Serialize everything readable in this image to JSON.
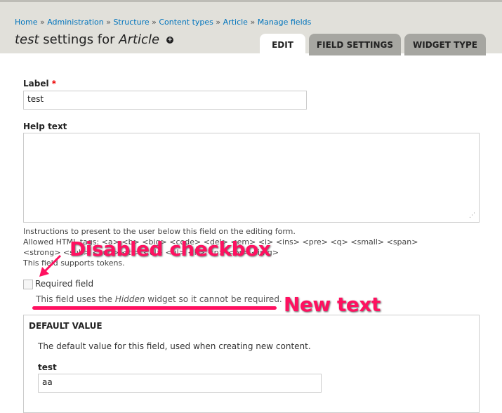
{
  "breadcrumb": [
    "Home",
    "Administration",
    "Structure",
    "Content types",
    "Article",
    "Manage fields"
  ],
  "title": {
    "field": "test",
    "middle": " settings for ",
    "bundle": "Article"
  },
  "tabs": [
    "EDIT",
    "FIELD SETTINGS",
    "WIDGET TYPE"
  ],
  "label": {
    "label": "Label",
    "required_mark": "*",
    "value": "test"
  },
  "help": {
    "label": "Help text",
    "value": "",
    "description": [
      "Instructions to present to the user below this field on the editing form.",
      "Allowed HTML tags: <a> <b> <big> <code> <del> <em> <i> <ins> <pre> <q> <small> <span>",
      "<strong> <sub> <sup> <tt> <ol> <ul> <li> <p> <br> <img>",
      "This field supports tokens."
    ]
  },
  "required": {
    "label": "Required field",
    "note_pre": "This field uses the ",
    "note_em": "Hidden",
    "note_post": " widget so it cannot be required."
  },
  "annotations": {
    "checkbox": "Disabled checkbox",
    "text": "New text"
  },
  "default_value": {
    "legend": "DEFAULT VALUE",
    "description": "The default value for this field, used when creating new content.",
    "field_label": "test",
    "field_value": "aa"
  }
}
